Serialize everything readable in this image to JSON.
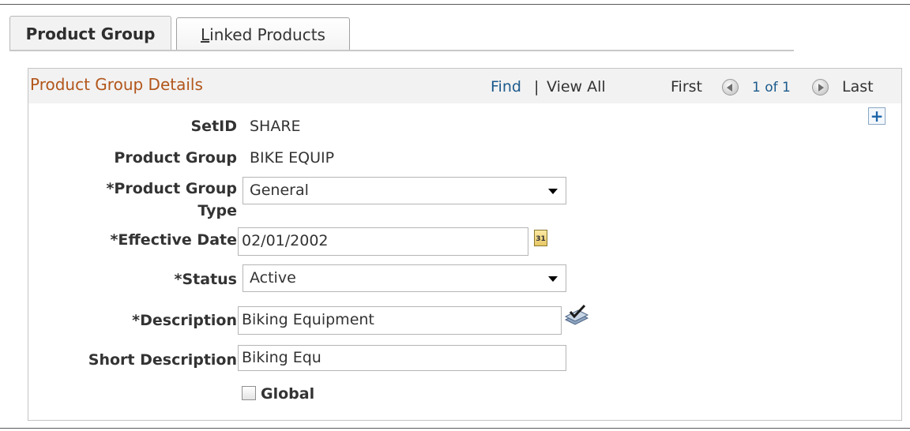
{
  "tabs": {
    "active_label": "Product Group",
    "inactive_accel": "L",
    "inactive_rest": "inked Products"
  },
  "group": {
    "title": "Product Group Details",
    "find": "Find",
    "separator": "|",
    "view_all": "View All",
    "first": "First",
    "count": "1 of 1",
    "last": "Last"
  },
  "form": {
    "setid_label": "SetID",
    "setid_value": "SHARE",
    "product_group_label": "Product Group",
    "product_group_value": "BIKE EQUIP",
    "type_label_line1": "*Product Group",
    "type_label_line2": "Type",
    "type_value": "General",
    "effdt_label": "*Effective Date",
    "effdt_value": "02/01/2002",
    "status_label": "*Status",
    "status_value": "Active",
    "descr_label": "*Description",
    "descr_value": "Biking Equipment",
    "short_descr_label": "Short Description",
    "short_descr_value": "Biking Equ",
    "global_label": "Global",
    "global_checked": false
  },
  "icons": {
    "add": "plus-icon",
    "calendar": "calendar-icon",
    "spellcheck": "spellcheck-icon",
    "prev": "previous-arrow-icon",
    "next": "next-arrow-icon"
  },
  "colors": {
    "group_title": "#b2561b",
    "link": "#1c5a8c",
    "header_bg": "#f2f2f2"
  }
}
